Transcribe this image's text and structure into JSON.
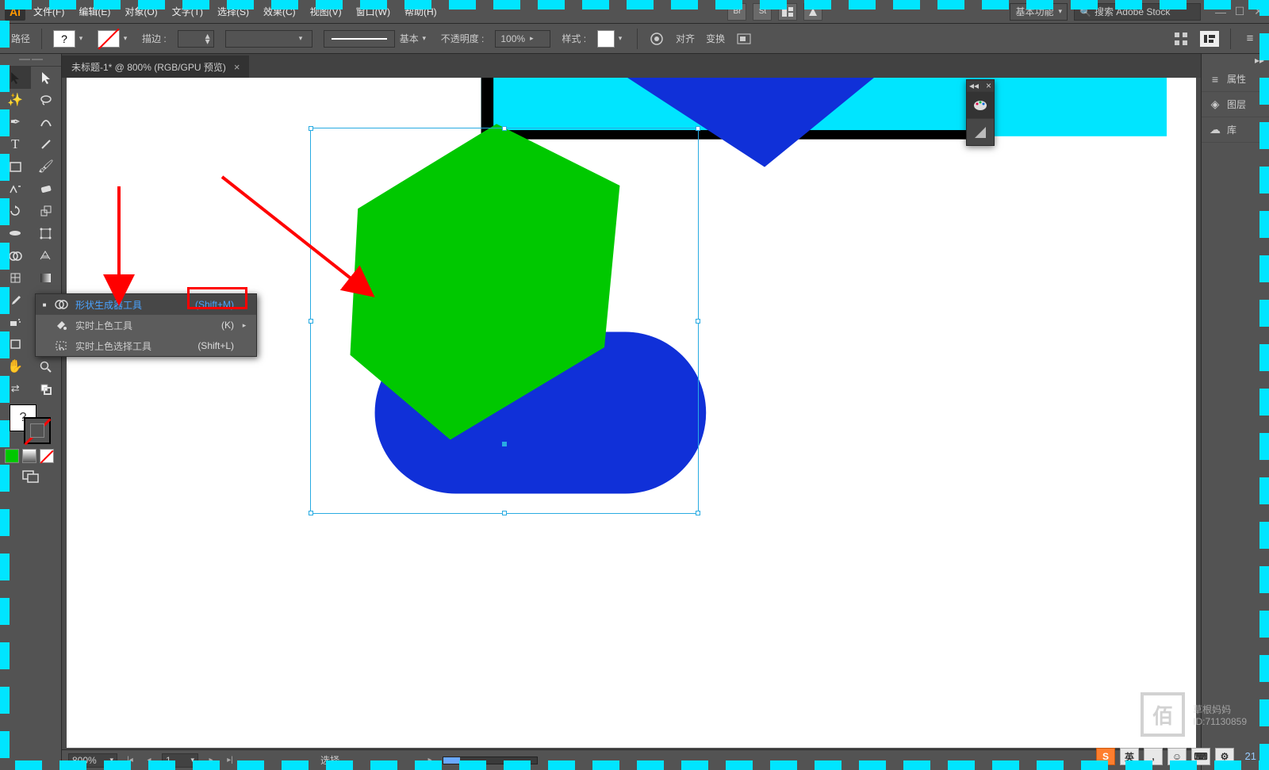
{
  "app": {
    "logo": "Ai"
  },
  "menubar": {
    "items": [
      "文件(F)",
      "编辑(E)",
      "对象(O)",
      "文字(T)",
      "选择(S)",
      "效果(C)",
      "视图(V)",
      "窗口(W)",
      "帮助(H)"
    ],
    "small_buttons": [
      "Br",
      "St"
    ],
    "workspace": "基本功能",
    "search_placeholder": "搜索 Adobe Stock"
  },
  "optionsbar": {
    "selection_label": "路径",
    "stroke_label": "描边 :",
    "stroke_value": "",
    "profile_label": "基本",
    "opacity_label": "不透明度 :",
    "opacity_value": "100%",
    "style_label": "样式 :",
    "align_label": "对齐",
    "transform_label": "变换"
  },
  "document_tab": {
    "title": "未标题-1* @ 800% (RGB/GPU 预览)"
  },
  "flyout": {
    "items": [
      {
        "label": "形状生成器工具",
        "shortcut": "(Shift+M)",
        "selected": true,
        "submenu": false
      },
      {
        "label": "实时上色工具",
        "shortcut": "(K)",
        "selected": false,
        "submenu": true
      },
      {
        "label": "实时上色选择工具",
        "shortcut": "(Shift+L)",
        "selected": false,
        "submenu": false
      }
    ]
  },
  "right_dock": {
    "items": [
      {
        "icon": "≡",
        "label": "属性"
      },
      {
        "icon": "◈",
        "label": "图层"
      },
      {
        "icon": "☁",
        "label": "库"
      }
    ]
  },
  "statusbar": {
    "zoom": "800%",
    "artboard": "1",
    "mode_label": "选择"
  },
  "watermark": {
    "name": "草根妈妈",
    "id": "ID:71130859"
  },
  "ime": {
    "buttons": [
      "英",
      ",",
      "☺",
      "⌨",
      "⚙"
    ]
  },
  "counter": "21"
}
